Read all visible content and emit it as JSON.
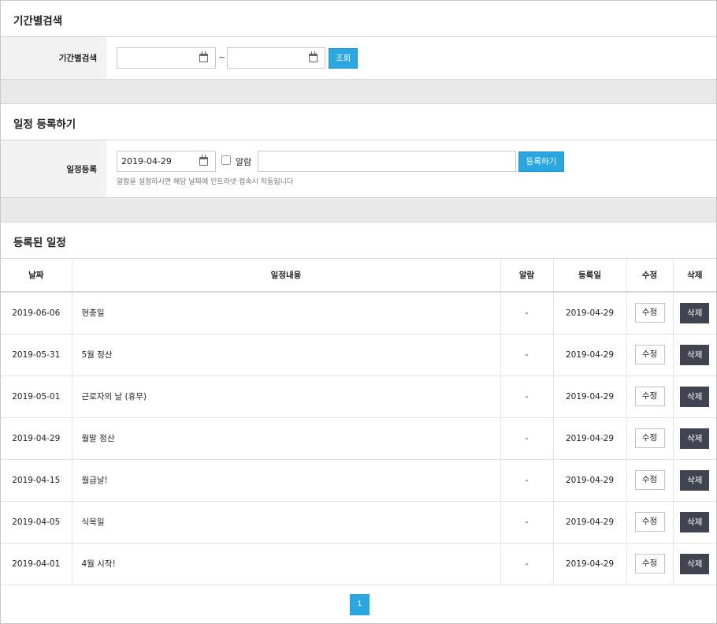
{
  "period_search": {
    "title": "기간별검색",
    "label": "기간별검색",
    "start_date": "",
    "tilde": "~",
    "end_date": "",
    "search_button": "조회"
  },
  "schedule_register": {
    "title": "일정 등록하기",
    "label": "일정등록",
    "date": "2019-04-29",
    "alarm_label": "알람",
    "alarm_checked": false,
    "content_value": "",
    "register_button": "등록하기",
    "hint": "알람을 설정하시면 해당 날짜에 인트라넷 접속시 작동됩니다"
  },
  "registered": {
    "title": "등록된 일정",
    "columns": [
      "날짜",
      "일정내용",
      "알람",
      "등록일",
      "수정",
      "삭제"
    ],
    "rows": [
      {
        "date": "2019-06-06",
        "content": "현충일",
        "alarm": "-",
        "registered": "2019-04-29",
        "edit": "수정",
        "delete": "삭제"
      },
      {
        "date": "2019-05-31",
        "content": "5월 정산",
        "alarm": "-",
        "registered": "2019-04-29",
        "edit": "수정",
        "delete": "삭제"
      },
      {
        "date": "2019-05-01",
        "content": "근로자의 날 (휴무)",
        "alarm": "-",
        "registered": "2019-04-29",
        "edit": "수정",
        "delete": "삭제"
      },
      {
        "date": "2019-04-29",
        "content": "월말 정산",
        "alarm": "-",
        "registered": "2019-04-29",
        "edit": "수정",
        "delete": "삭제"
      },
      {
        "date": "2019-04-15",
        "content": "월급날!",
        "alarm": "-",
        "registered": "2019-04-29",
        "edit": "수정",
        "delete": "삭제"
      },
      {
        "date": "2019-04-05",
        "content": "식목일",
        "alarm": "-",
        "registered": "2019-04-29",
        "edit": "수정",
        "delete": "삭제"
      },
      {
        "date": "2019-04-01",
        "content": "4월 시작!",
        "alarm": "-",
        "registered": "2019-04-29",
        "edit": "수정",
        "delete": "삭제"
      }
    ]
  },
  "pagination": {
    "current": "1"
  },
  "colors": {
    "accent": "#2aa7e0",
    "delete_button": "#3f4450",
    "label_bg": "#f2f2f2",
    "gap_bg": "#e9e9e9"
  },
  "icons": {
    "date_picker": "calendar-icon"
  }
}
